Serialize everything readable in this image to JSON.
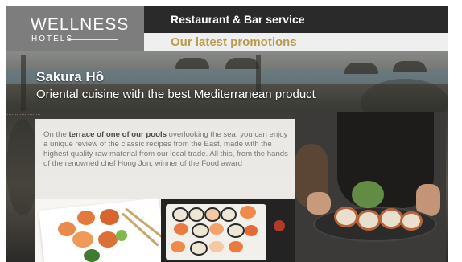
{
  "brand": {
    "name": "WELLNESS",
    "sub": "HOTELS"
  },
  "header": {
    "title": "Restaurant & Bar service",
    "promo": "Our latest promotions"
  },
  "main": {
    "heading": "Sakura Hô",
    "subheading": "Oriental cuisine with the best Mediterranean product",
    "desc_1": "On the ",
    "desc_bold": "terrace of one of our pools",
    "desc_2": " overlooking the sea, you can enjoy a unique review of the classic recipes from the East, made with the highest quality raw material from our local trade. All this, from the hands of the renowned chef Hong Jon, winner of the Food award"
  },
  "colors": {
    "logo_bg": "#7d7d7d",
    "title_bg": "#2a2a2a",
    "promo_bg": "#efefef",
    "promo_text": "#b89b4c",
    "panel_bg": "#f4f3f0",
    "desc_text": "#777777"
  }
}
